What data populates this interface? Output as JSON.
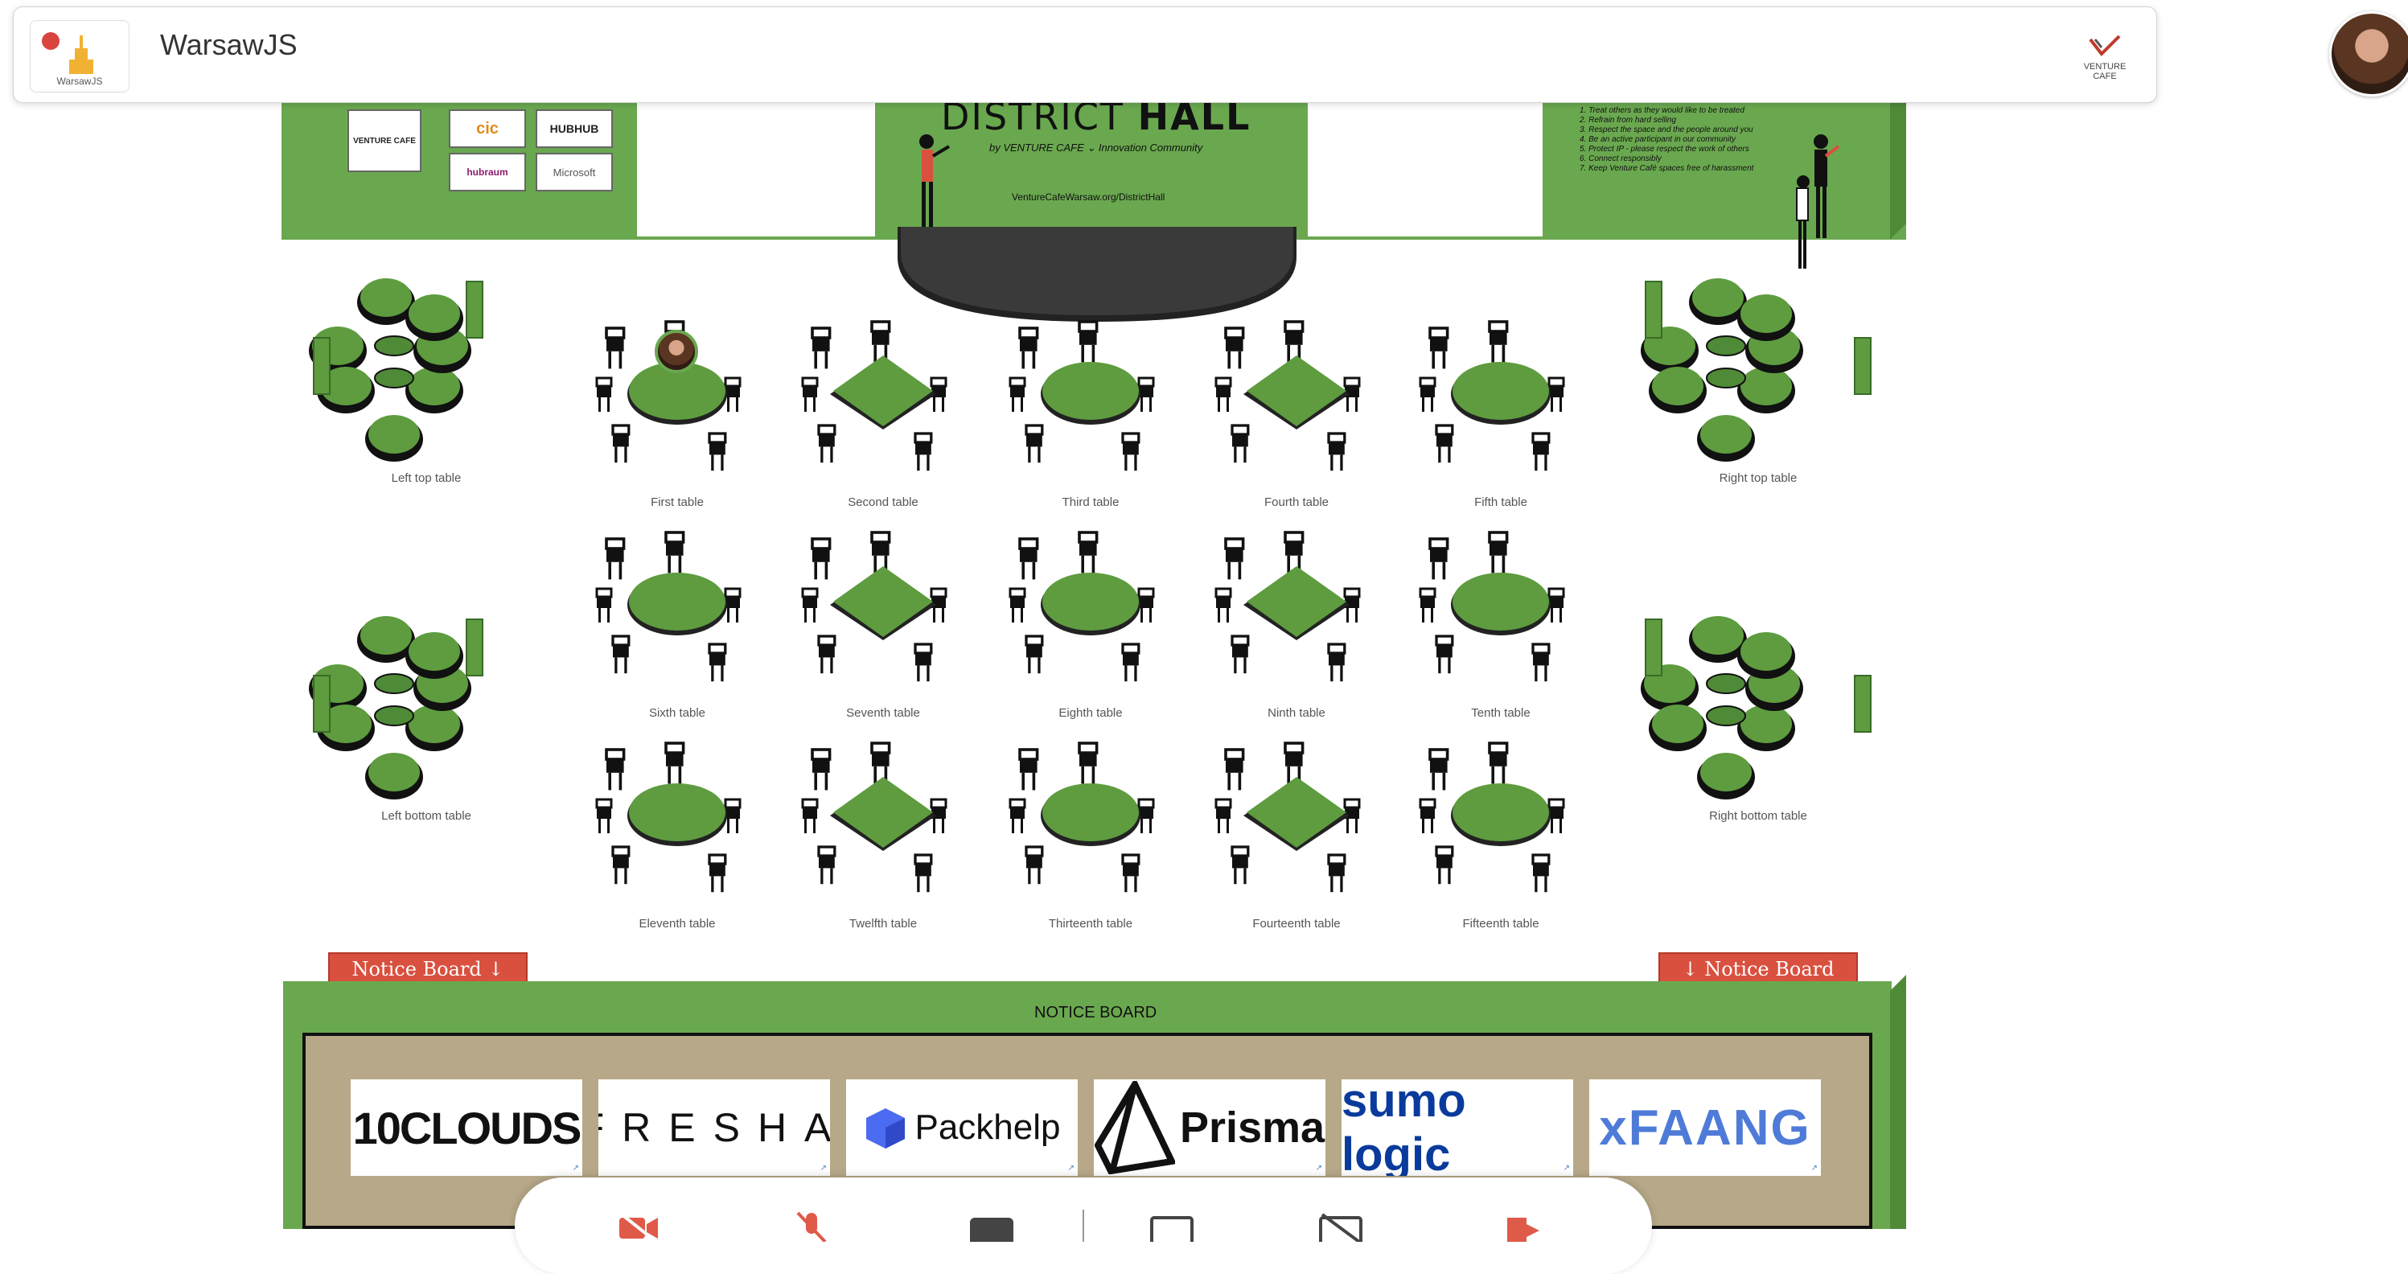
{
  "header": {
    "app_title": "WarsawJS",
    "app_logo_caption": "WarsawJS",
    "partner_logo_caption": "VENTURE CAFE"
  },
  "stage": {
    "title_light": "DISTRICT ",
    "title_bold": "HALL",
    "subtitle": "by VENTURE CAFE ⌄ Innovation Community",
    "url": "VentureCafeWarsaw.org/DistrictHall",
    "rules": [
      "1. Treat others as they would like to be treated",
      "2. Refrain from hard selling",
      "3. Respect the space and the people around you",
      "4. Be an active participant in our community",
      "5. Protect IP - please respect the work of others",
      "6. Connect responsibly",
      "7. Keep Venture Café spaces free of harassment"
    ],
    "partner_logos": [
      "VENTURE CAFE",
      "cic",
      "HUBHUB",
      "hubraum",
      "Microsoft"
    ]
  },
  "tables": {
    "lounge": [
      {
        "label": "Left top table"
      },
      {
        "label": "Right top table"
      },
      {
        "label": "Left bottom table"
      },
      {
        "label": "Right bottom table"
      }
    ],
    "grid": [
      {
        "label": "First table",
        "shape": "round"
      },
      {
        "label": "Second table",
        "shape": "diamond"
      },
      {
        "label": "Third table",
        "shape": "round"
      },
      {
        "label": "Fourth table",
        "shape": "diamond"
      },
      {
        "label": "Fifth table",
        "shape": "round"
      },
      {
        "label": "Sixth table",
        "shape": "round"
      },
      {
        "label": "Seventh table",
        "shape": "diamond"
      },
      {
        "label": "Eighth table",
        "shape": "round"
      },
      {
        "label": "Ninth table",
        "shape": "diamond"
      },
      {
        "label": "Tenth table",
        "shape": "round"
      },
      {
        "label": "Eleventh table",
        "shape": "round"
      },
      {
        "label": "Twelfth table",
        "shape": "diamond"
      },
      {
        "label": "Thirteenth table",
        "shape": "round"
      },
      {
        "label": "Fourteenth table",
        "shape": "diamond"
      },
      {
        "label": "Fifteenth table",
        "shape": "round"
      }
    ]
  },
  "notice_board": {
    "heading": "NOTICE BOARD",
    "left_tab": "Notice Board ↓",
    "right_tab": "↓ Notice Board",
    "sponsors": [
      "10CLOUDS",
      "FRESHA",
      "Packhelp",
      "Prisma",
      "sumo logic",
      "xFAANG"
    ]
  },
  "toolbar": {
    "buttons": [
      "camera-off-icon",
      "mic-off-icon",
      "stop-icon",
      "screen-share-icon",
      "screen-share-off-icon",
      "leave-icon"
    ]
  },
  "colors": {
    "wall_green": "#6aa84f",
    "table_green": "#5e9c3f",
    "notice_red": "#d9503f",
    "cork": "#b6a888"
  }
}
